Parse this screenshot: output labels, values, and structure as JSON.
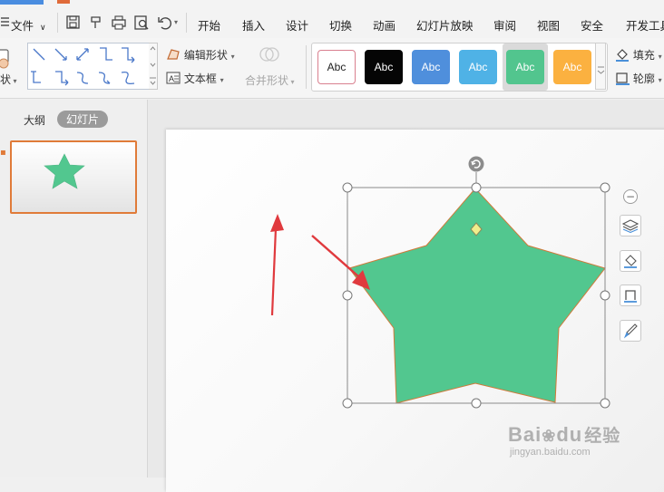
{
  "menu": {
    "file": "文件",
    "tabs": [
      "开始",
      "插入",
      "设计",
      "切换",
      "动画",
      "幻灯片放映",
      "审阅",
      "视图",
      "安全",
      "开发工具"
    ]
  },
  "ribbon": {
    "shape_label_partial": "状",
    "edit_shape": "编辑形状",
    "text_box": "文本框",
    "merge_shapes": "合并形状",
    "style_samples": [
      {
        "label": "Abc",
        "bg": "#ffffff",
        "fg": "#222222",
        "border": "#d9808f"
      },
      {
        "label": "Abc",
        "bg": "#050505",
        "fg": "#ffffff",
        "border": "#050505"
      },
      {
        "label": "Abc",
        "bg": "#4f8fdc",
        "fg": "#ffffff",
        "border": "#4f8fdc"
      },
      {
        "label": "Abc",
        "bg": "#4fb2e6",
        "fg": "#ffffff",
        "border": "#4fb2e6"
      },
      {
        "label": "Abc",
        "bg": "#52c58e",
        "fg": "#ffffff",
        "border": "#52c58e"
      },
      {
        "label": "Abc",
        "bg": "#fbb140",
        "fg": "#ffffff",
        "border": "#fbb140"
      }
    ],
    "fill": "填充",
    "outline": "轮廓"
  },
  "left_panel": {
    "tab_outline": "大纲",
    "tab_slides": "幻灯片"
  },
  "watermark": {
    "brand": "Bai",
    "brand2": "du",
    "suffix": "经验",
    "url": "jingyan.baidu.com"
  },
  "colors": {
    "star_fill": "#52c78f",
    "star_stroke": "#d07a3a",
    "arrow": "#e03a3e",
    "accent_orange": "#e07b39",
    "handle_yellow": "#f1ee8c"
  }
}
